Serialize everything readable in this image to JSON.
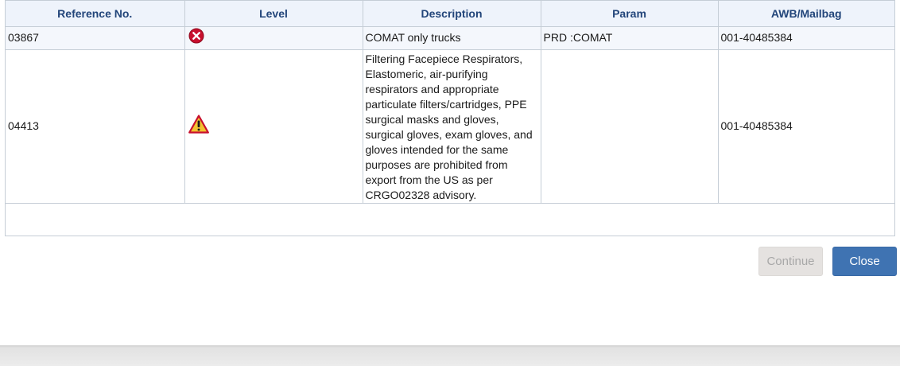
{
  "table": {
    "headers": {
      "reference": "Reference No.",
      "level": "Level",
      "description": "Description",
      "param": "Param",
      "awb": "AWB/Mailbag"
    },
    "rows": [
      {
        "reference": "03867",
        "level_icon": "error-icon",
        "description": "COMAT only trucks",
        "param": "PRD :COMAT",
        "awb": "001-40485384"
      },
      {
        "reference": "04413",
        "level_icon": "warning-icon",
        "description": "Filtering Facepiece Respirators, Elastomeric, air-purifying respirators and appropriate particulate filters/cartridges, PPE surgical masks and gloves, surgical gloves, exam gloves, and gloves intended for the same purposes are prohibited from export from the US as per CRGO02328 advisory.",
        "param": "",
        "awb": "001-40485384"
      }
    ]
  },
  "buttons": {
    "continue_label": "Continue",
    "continue_disabled": true,
    "close_label": "Close"
  },
  "colors": {
    "header_text": "#22457a",
    "header_bg": "#eef3fb",
    "error": "#c8102e",
    "warning": "#f2c230",
    "close_button": "#3f73b2"
  }
}
